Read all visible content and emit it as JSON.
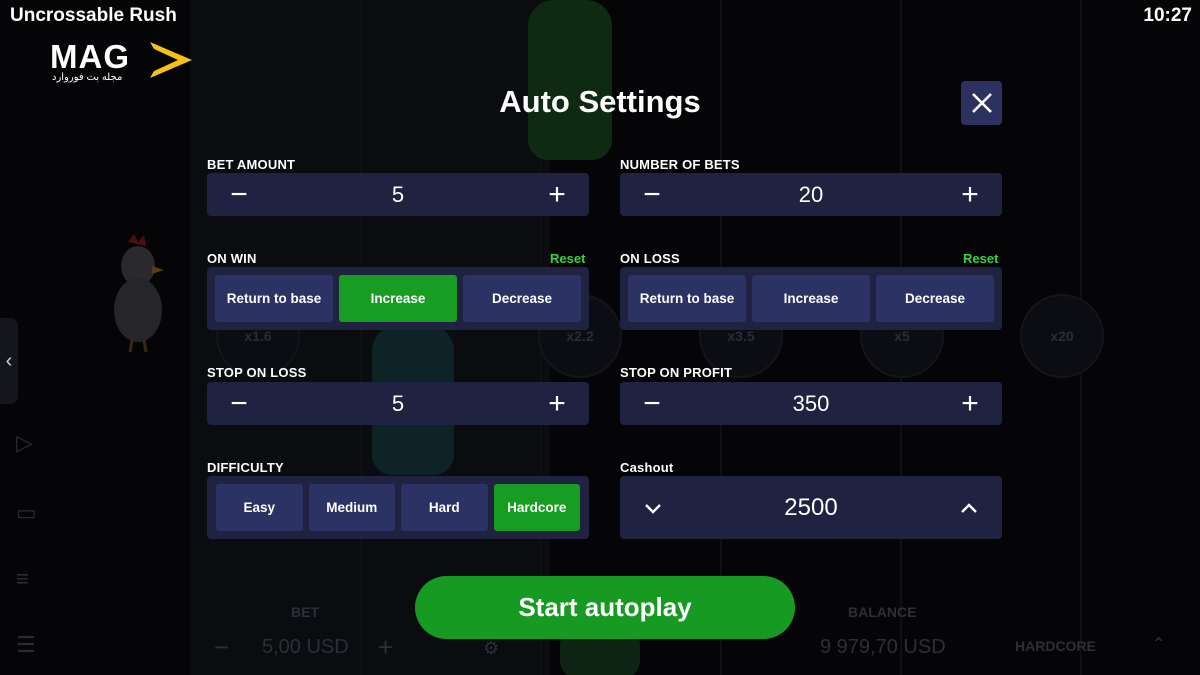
{
  "app": {
    "title": "Uncrossable Rush",
    "clock": "10:27"
  },
  "logo": {
    "text": "MAG",
    "subtitle": "مجله بت فوروارد"
  },
  "background": {
    "multipliers": [
      "x1.6",
      "x2.2",
      "x3.5",
      "x5",
      "x20"
    ],
    "bet_label": "BET",
    "bet_value": "5,00 USD",
    "balance_label": "BALANCE",
    "balance_value": "9 979,70 USD",
    "difficulty_value": "HARDCORE"
  },
  "modal": {
    "title": "Auto Settings",
    "close_icon": "close-icon",
    "bet_amount": {
      "label": "BET AMOUNT",
      "value": "5",
      "minus": "−",
      "plus": "+"
    },
    "number_of_bets": {
      "label": "NUMBER OF BETS",
      "value": "20",
      "minus": "−",
      "plus": "+"
    },
    "on_win": {
      "label": "ON WIN",
      "reset": "Reset",
      "options": [
        "Return to base",
        "Increase",
        "Decrease"
      ],
      "selected": "Increase"
    },
    "on_loss": {
      "label": "ON LOSS",
      "reset": "Reset",
      "options": [
        "Return to base",
        "Increase",
        "Decrease"
      ],
      "selected": null
    },
    "stop_on_loss": {
      "label": "STOP ON LOSS",
      "value": "5",
      "minus": "−",
      "plus": "+"
    },
    "stop_on_profit": {
      "label": "STOP ON PROFIT",
      "value": "350",
      "minus": "−",
      "plus": "+"
    },
    "difficulty": {
      "label": "DIFFICULTY",
      "options": [
        "Easy",
        "Medium",
        "Hard",
        "Hardcore"
      ],
      "selected": "Hardcore"
    },
    "cashout": {
      "label": "Cashout",
      "value": "2500"
    },
    "start_button": "Start autoplay"
  },
  "colors": {
    "panel": "#1f2240",
    "option": "#2c3263",
    "active": "#179d22",
    "reset": "#35d43a"
  }
}
